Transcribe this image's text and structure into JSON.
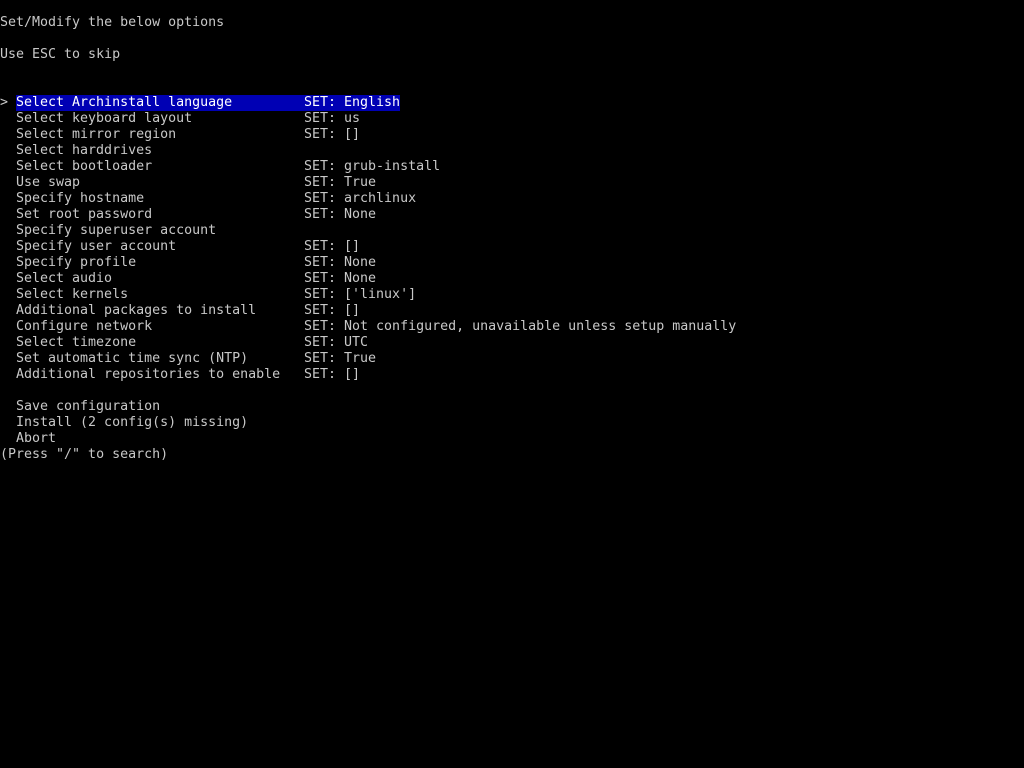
{
  "header": {
    "title": "Set/Modify the below options",
    "hint": "Use ESC to skip"
  },
  "menu": {
    "cursor_glyph": ">",
    "selected_index": 0,
    "highlight_color": "#0000b4",
    "items": [
      {
        "label": "Select Archinstall language",
        "value": "SET: English"
      },
      {
        "label": "Select keyboard layout",
        "value": "SET: us"
      },
      {
        "label": "Select mirror region",
        "value": "SET: []"
      },
      {
        "label": "Select harddrives",
        "value": ""
      },
      {
        "label": "Select bootloader",
        "value": "SET: grub-install"
      },
      {
        "label": "Use swap",
        "value": "SET: True"
      },
      {
        "label": "Specify hostname",
        "value": "SET: archlinux"
      },
      {
        "label": "Set root password",
        "value": "SET: None"
      },
      {
        "label": "Specify superuser account",
        "value": ""
      },
      {
        "label": "Specify user account",
        "value": "SET: []"
      },
      {
        "label": "Specify profile",
        "value": "SET: None"
      },
      {
        "label": "Select audio",
        "value": "SET: None"
      },
      {
        "label": "Select kernels",
        "value": "SET: ['linux']"
      },
      {
        "label": "Additional packages to install",
        "value": "SET: []"
      },
      {
        "label": "Configure network",
        "value": "SET: Not configured, unavailable unless setup manually"
      },
      {
        "label": "Select timezone",
        "value": "SET: UTC"
      },
      {
        "label": "Set automatic time sync (NTP)",
        "value": "SET: True"
      },
      {
        "label": "Additional repositories to enable",
        "value": "SET: []"
      }
    ],
    "actions": [
      {
        "label": "Save configuration"
      },
      {
        "label": "Install (2 config(s) missing)"
      },
      {
        "label": "Abort"
      }
    ]
  },
  "footer": {
    "search_hint": "(Press \"/\" to search)"
  }
}
